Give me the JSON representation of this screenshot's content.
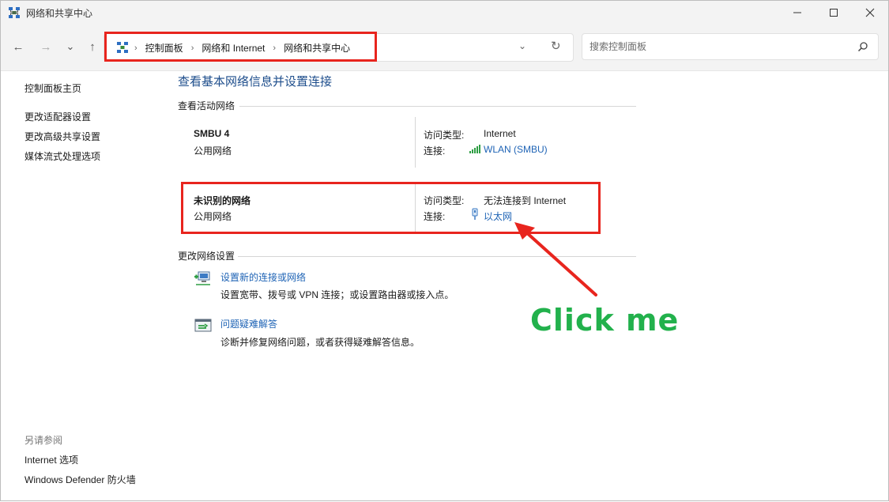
{
  "window": {
    "title": "网络和共享中心",
    "controls": {
      "minimize": "—",
      "maximize": "☐",
      "close": "✕"
    }
  },
  "nav": {
    "back": "←",
    "forward": "→",
    "recent": "⌄",
    "up": "↑",
    "breadcrumb": [
      "控制面板",
      "网络和 Internet",
      "网络和共享中心"
    ],
    "breadcrumb_sep": "›",
    "dropdown": "⌄",
    "refresh": "↻",
    "search_placeholder": "搜索控制面板"
  },
  "sidebar": {
    "links": [
      "控制面板主页",
      "更改适配器设置",
      "更改高级共享设置",
      "媒体流式处理选项"
    ],
    "see_also_heading": "另请参阅",
    "see_also": [
      "Internet 选项",
      "Windows Defender 防火墙"
    ]
  },
  "main": {
    "title": "查看基本网络信息并设置连接",
    "active_heading": "查看活动网络",
    "networks": [
      {
        "name": "SMBU 4",
        "type": "公用网络",
        "access_label": "访问类型:",
        "access_value": "Internet",
        "conn_label": "连接:",
        "conn_value": "WLAN (SMBU)",
        "conn_icon": "wifi-signal-icon"
      },
      {
        "name": "未识别的网络",
        "type": "公用网络",
        "access_label": "访问类型:",
        "access_value": "无法连接到 Internet",
        "conn_label": "连接:",
        "conn_value": "以太网",
        "conn_icon": "ethernet-icon"
      }
    ],
    "change_heading": "更改网络设置",
    "tasks": [
      {
        "link": "设置新的连接或网络",
        "desc": "设置宽带、拨号或 VPN 连接；或设置路由器或接入点。",
        "icon": "new-connection-icon"
      },
      {
        "link": "问题疑难解答",
        "desc": "诊断并修复网络问题，或者获得疑难解答信息。",
        "icon": "troubleshoot-icon"
      }
    ]
  },
  "annotation": {
    "text": "Click me",
    "color": "#22b14c",
    "highlight_color": "#e8251e"
  },
  "colors": {
    "link": "#1e63b5",
    "title": "#1e4e8c"
  }
}
